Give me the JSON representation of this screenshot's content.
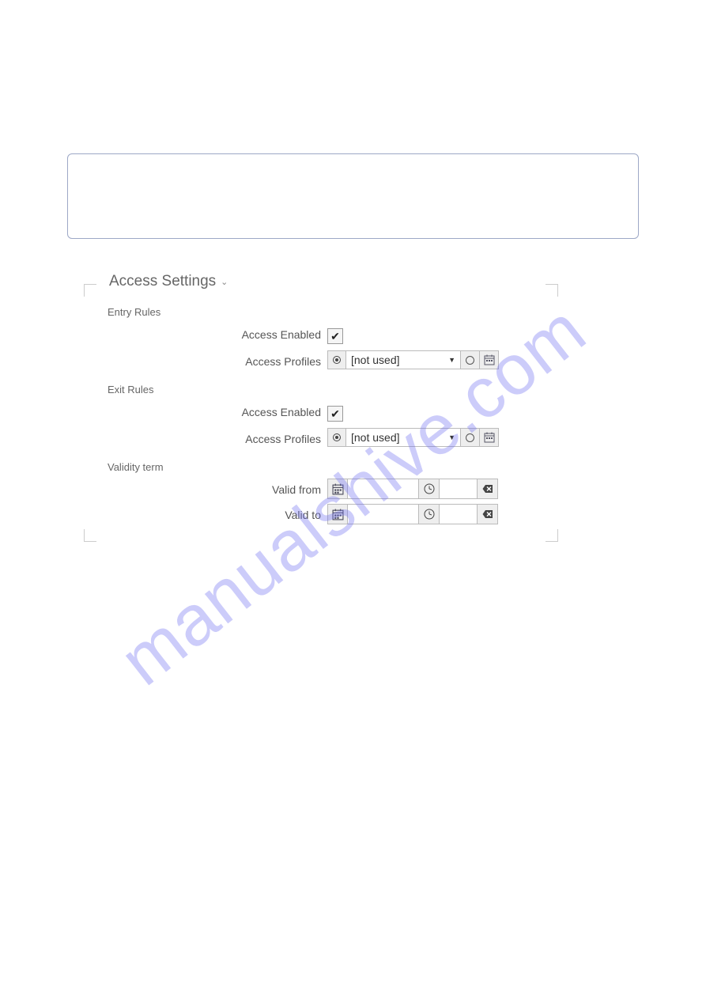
{
  "watermark": "manualshive.com",
  "access_settings": {
    "title": "Access Settings",
    "entry_rules": {
      "heading": "Entry Rules",
      "access_enabled_label": "Access Enabled",
      "access_enabled_checked": true,
      "access_profiles_label": "Access Profiles",
      "access_profiles_value": "[not used]"
    },
    "exit_rules": {
      "heading": "Exit Rules",
      "access_enabled_label": "Access Enabled",
      "access_enabled_checked": true,
      "access_profiles_label": "Access Profiles",
      "access_profiles_value": "[not used]"
    },
    "validity_term": {
      "heading": "Validity term",
      "valid_from_label": "Valid from",
      "valid_from_date": "",
      "valid_from_time": "",
      "valid_to_label": "Valid to",
      "valid_to_date": "",
      "valid_to_time": ""
    }
  }
}
